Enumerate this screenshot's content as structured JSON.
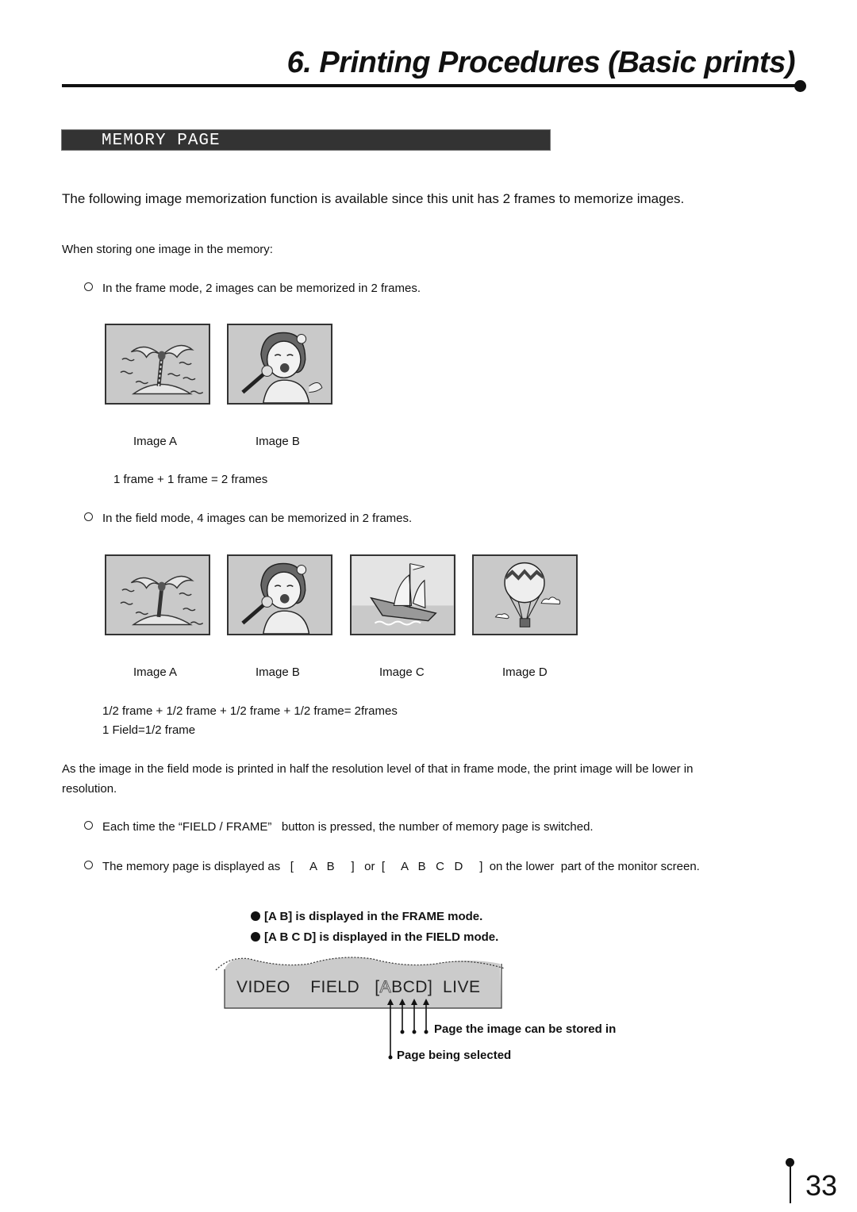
{
  "header": {
    "chapter_title": "6. Printing Procedures (Basic prints)"
  },
  "section": {
    "title": "MEMORY  PAGE"
  },
  "intro": "The following image memorization function is available since this unit has 2 frames to memorize images.",
  "storing_label": "When storing one image in the memory:",
  "frame_mode": {
    "bullet": "In the frame mode, 2 images can be memorized in 2 frames.",
    "images": [
      {
        "caption": "Image A",
        "icon": "palm-island-icon"
      },
      {
        "caption": "Image B",
        "icon": "singer-girl-icon"
      }
    ],
    "equation": "1 frame + 1 frame  = 2 frames"
  },
  "field_mode": {
    "bullet": "In the field mode, 4 images can be memorized in 2 frames.",
    "images": [
      {
        "caption": "Image A",
        "icon": "palm-island-icon"
      },
      {
        "caption": "Image B",
        "icon": "singer-girl-icon"
      },
      {
        "caption": "Image C",
        "icon": "sailing-ship-icon"
      },
      {
        "caption": "Image D",
        "icon": "hot-air-balloon-icon"
      }
    ],
    "equation": "1/2 frame + 1/2 frame + 1/2 frame + 1/2 frame= 2frames",
    "field_note": "1 Field=1/2 frame"
  },
  "resolution_note": "As the image in the field mode is printed in half the resolution level of that in frame mode, the print image will be lower in",
  "resolution_note_cont": "resolution.",
  "bullets": [
    "Each time the “FIELD / FRAME”   button is pressed, the number of memory page is switched.",
    "The memory page is displayed as   [     A   B     ]   or  [     A   B   C   D     ]  on the lower  part of the monitor screen."
  ],
  "notes": [
    "[A B] is displayed in the FRAME mode.",
    "[A B C D] is displayed in the FIELD mode."
  ],
  "monitor": {
    "video": "VIDEO",
    "field": "FIELD",
    "bracket_open": "[",
    "selected_page": "A",
    "other_pages": "BCD",
    "bracket_close": "]",
    "live": "LIVE"
  },
  "callouts": {
    "storable": "Page the image can be stored in",
    "selected": "Page being selected"
  },
  "page_number": "33"
}
